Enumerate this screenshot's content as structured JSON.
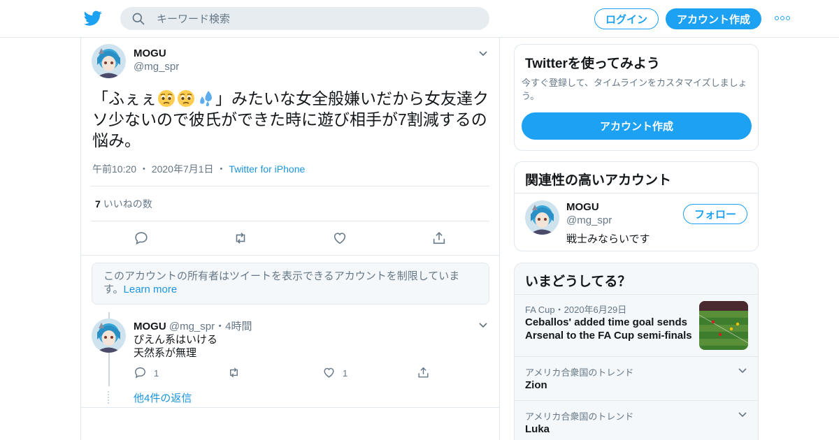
{
  "header": {
    "search_placeholder": "キーワード検索",
    "login_label": "ログイン",
    "signup_label": "アカウント作成"
  },
  "tweet": {
    "author_name": "MOGU",
    "author_handle": "@mg_spr",
    "text_part1": "「ふぇぇ",
    "text_part2": "」みたいな女全般嫌いだから女友達クソ少ないので彼氏ができた時に遊び相手が7割減するの悩み。",
    "emojis": [
      "pleading-face-icon",
      "pleading-face-icon",
      "sweat-droplets-icon"
    ],
    "time": "午前10:20",
    "date": "2020年7月1日",
    "via": "Twitter for iPhone",
    "likes_count": "7",
    "likes_label": "いいねの数"
  },
  "notice": {
    "text": "このアカウントの所有者はツイートを表示できるアカウントを制限しています。",
    "link": "Learn more"
  },
  "reply": {
    "author_name": "MOGU",
    "author_handle": "@mg_spr",
    "dot": "・",
    "time": "4時間",
    "line1": "ぴえん系はいける",
    "line2": "天然系が無理",
    "reply_count": "1",
    "like_count": "1",
    "more_replies": "他4件の返信"
  },
  "sidebar": {
    "signup_card": {
      "title": "Twitterを使ってみよう",
      "desc": "今すぐ登録して、タイムラインをカスタマイズしましょう。",
      "button": "アカウント作成"
    },
    "related_card": {
      "title": "関連性の高いアカウント",
      "name": "MOGU",
      "handle": "@mg_spr",
      "bio": "戦士みならいです",
      "follow_button": "フォロー"
    },
    "trends_card": {
      "title": "いまどうしてる？",
      "items": [
        {
          "meta": "FA Cup・2020年6月29日",
          "headline": "Ceballos' added time goal sends Arsenal to the FA Cup semi-finals"
        },
        {
          "meta": "アメリカ合衆国のトレンド",
          "name": "Zion"
        },
        {
          "meta": "アメリカ合衆国のトレンド",
          "name": "Luka"
        }
      ]
    }
  },
  "colors": {
    "accent": "#1da1f2",
    "link": "#1b95e0",
    "secondary_text": "#657786",
    "border": "#e1e8ed"
  }
}
